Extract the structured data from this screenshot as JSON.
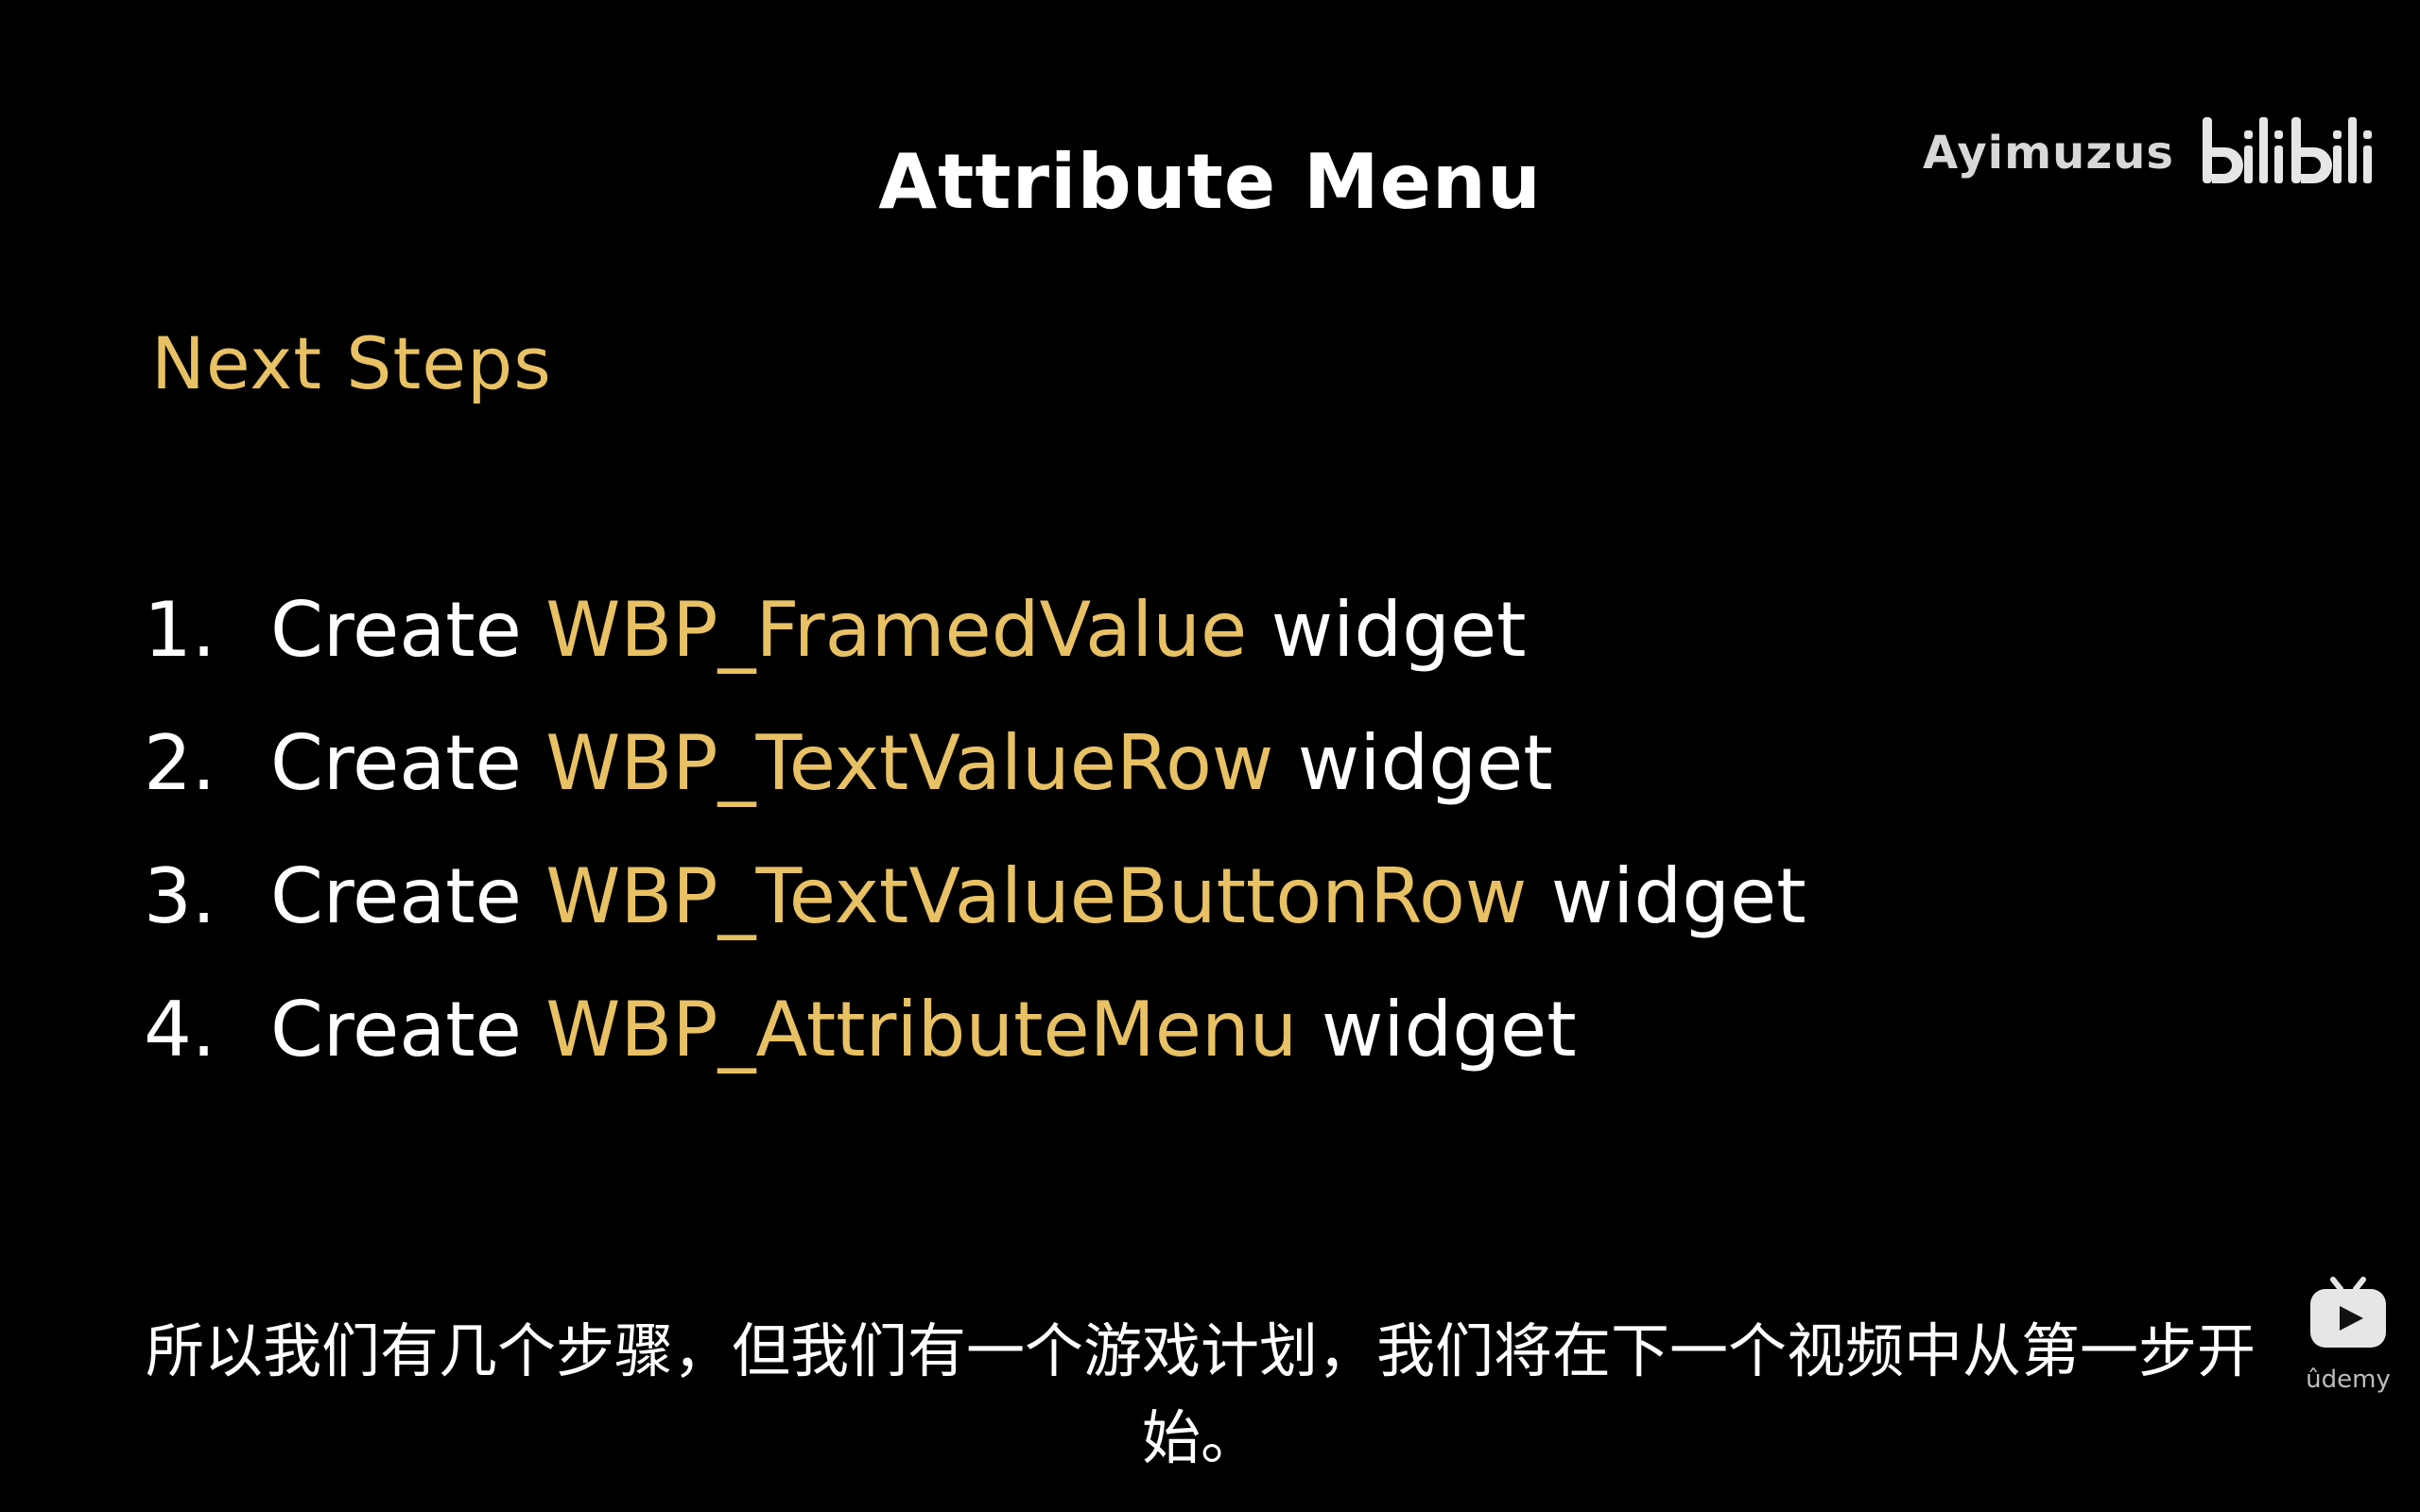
{
  "slide": {
    "title": "Attribute Menu",
    "section_heading": "Next Steps",
    "steps": [
      {
        "number": "1.",
        "verb": "Create",
        "name": "WBP_FramedValue",
        "suffix": "widget"
      },
      {
        "number": "2.",
        "verb": "Create",
        "name": "WBP_TextValueRow",
        "suffix": "widget"
      },
      {
        "number": "3.",
        "verb": "Create",
        "name": "WBP_TextValueButtonRow",
        "suffix": "widget"
      },
      {
        "number": "4.",
        "verb": "Create",
        "name": "WBP_AttributeMenu",
        "suffix": "widget"
      }
    ]
  },
  "watermark": {
    "user": "Ayimuzus",
    "logo_text": "bilibili",
    "logo_icon": "bilibili-logo"
  },
  "subtitle": {
    "line1": "所以我们有几个步骤，但我们有一个游戏计划，我们将在下一个视频中从第一步开",
    "line2": "始。"
  },
  "player_badge": {
    "icon": "tv-play-icon",
    "label": "ûdemy"
  },
  "colors": {
    "background": "#000000",
    "text": "#ffffff",
    "accent": "#e8c164",
    "watermark": "#d8d8d8"
  }
}
